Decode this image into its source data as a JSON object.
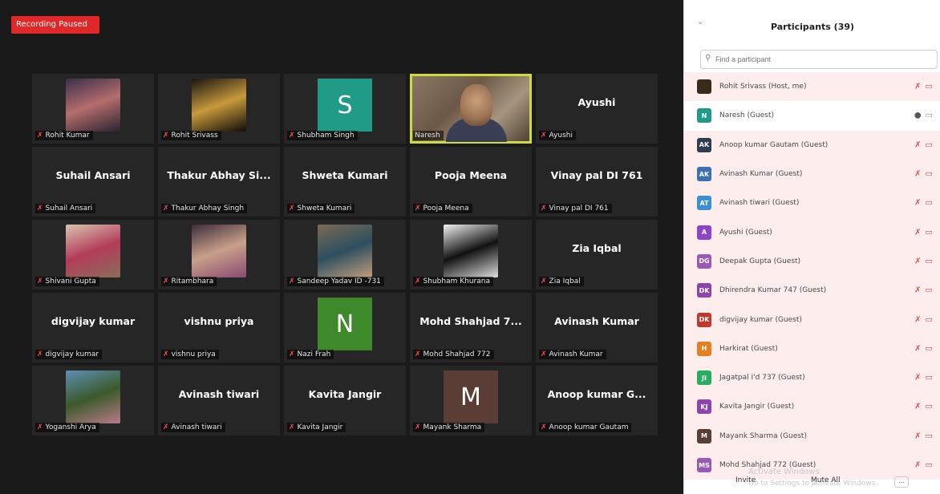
{
  "meeting": {
    "recording_status": "Recording Paused",
    "tiles": [
      {
        "name": "",
        "label": "Rohit Kumar",
        "kind": "photo",
        "photo_colors": [
          "#3b2f4a",
          "#b56d6d",
          "#2a2430"
        ]
      },
      {
        "name": "",
        "label": "Rohit Srivass",
        "kind": "photo",
        "photo_colors": [
          "#1a1410",
          "#c79a3b",
          "#0e0b08"
        ]
      },
      {
        "name": "",
        "label": "Shubham Singh",
        "kind": "letter",
        "letter": "S",
        "color": "#1f9b87"
      },
      {
        "name": "",
        "label": "Naresh",
        "kind": "video",
        "mic": "on"
      },
      {
        "name": "Ayushi",
        "label": "Ayushi",
        "kind": "name"
      },
      {
        "name": "Suhail Ansari",
        "label": "Suhail Ansari",
        "kind": "name"
      },
      {
        "name": "Thakur Abhay Si...",
        "label": "Thakur Abhay Singh",
        "kind": "name"
      },
      {
        "name": "Shweta Kumari",
        "label": "Shweta Kumari",
        "kind": "name"
      },
      {
        "name": "Pooja Meena",
        "label": "Pooja Meena",
        "kind": "name"
      },
      {
        "name": "Vinay pal  DI 761",
        "label": "Vinay pal  DI 761",
        "kind": "name"
      },
      {
        "name": "",
        "label": "Shivani Gupta",
        "kind": "photo",
        "photo_colors": [
          "#d9c5b0",
          "#b33c5a",
          "#8a6e57"
        ]
      },
      {
        "name": "",
        "label": "Ritambhara",
        "kind": "photo",
        "photo_colors": [
          "#3d2c3a",
          "#c8a08a",
          "#8a4a70"
        ]
      },
      {
        "name": "",
        "label": "Sandeep Yadav ID -731",
        "kind": "photo",
        "photo_colors": [
          "#7a6a55",
          "#2d4f5f",
          "#c29d7d"
        ]
      },
      {
        "name": "",
        "label": "Shubham Khurana",
        "kind": "photo",
        "photo_colors": [
          "#f2f2f2",
          "#111111",
          "#dddddd"
        ]
      },
      {
        "name": "Zia Iqbal",
        "label": "Zia Iqbal",
        "kind": "name"
      },
      {
        "name": "digvijay kumar",
        "label": "digvijay kumar",
        "kind": "name"
      },
      {
        "name": "vishnu priya",
        "label": "vishnu priya",
        "kind": "name"
      },
      {
        "name": "",
        "label": "Nazi Frah",
        "kind": "letter",
        "letter": "N",
        "color": "#3e8a2b"
      },
      {
        "name": "Mohd Shahjad 7...",
        "label": "Mohd Shahjad 772",
        "kind": "name"
      },
      {
        "name": "Avinash Kumar",
        "label": "Avinash Kumar",
        "kind": "name"
      },
      {
        "name": "",
        "label": "Yoganshi Arya",
        "kind": "photo",
        "photo_colors": [
          "#5d8fb4",
          "#3b5a2a",
          "#b97a8a"
        ]
      },
      {
        "name": "Avinash tiwari",
        "label": "Avinash tiwari",
        "kind": "name"
      },
      {
        "name": "Kavita Jangir",
        "label": "Kavita Jangir",
        "kind": "name"
      },
      {
        "name": "",
        "label": "Mayank Sharma",
        "kind": "letter",
        "letter": "M",
        "color": "#5a3e35"
      },
      {
        "name": "Anoop kumar G...",
        "label": "Anoop kumar Gautam",
        "kind": "name"
      }
    ]
  },
  "panel": {
    "title": "Participants (39)",
    "search_placeholder": "Find a participant",
    "participants": [
      {
        "initials": "",
        "name": "Rohit Srivass (Host, me)",
        "color": "#3a2a1a",
        "mic": "muted"
      },
      {
        "initials": "N",
        "name": "Naresh (Guest)",
        "color": "#1f9b87",
        "mic": "on"
      },
      {
        "initials": "AK",
        "name": "Anoop kumar Gautam (Guest)",
        "color": "#2c3e50",
        "mic": "muted"
      },
      {
        "initials": "AK",
        "name": "Avinash Kumar (Guest)",
        "color": "#3b6fb6",
        "mic": "muted"
      },
      {
        "initials": "AT",
        "name": "Avinash tiwari (Guest)",
        "color": "#3b8fd6",
        "mic": "muted"
      },
      {
        "initials": "A",
        "name": "Ayushi (Guest)",
        "color": "#8e44c9",
        "mic": "muted"
      },
      {
        "initials": "DG",
        "name": "Deepak Gupta (Guest)",
        "color": "#9b59b6",
        "mic": "muted"
      },
      {
        "initials": "DK",
        "name": "Dhirendra Kumar 747 (Guest)",
        "color": "#8e44ad",
        "mic": "muted"
      },
      {
        "initials": "DK",
        "name": "digvijay kumar (Guest)",
        "color": "#c0392b",
        "mic": "muted"
      },
      {
        "initials": "H",
        "name": "Harkirat (Guest)",
        "color": "#e67e22",
        "mic": "muted"
      },
      {
        "initials": "JI",
        "name": "Jagatpal I'd 737 (Guest)",
        "color": "#27ae60",
        "mic": "muted"
      },
      {
        "initials": "KJ",
        "name": "Kavita Jangir (Guest)",
        "color": "#8e44ad",
        "mic": "muted"
      },
      {
        "initials": "M",
        "name": "Mayank Sharma (Guest)",
        "color": "#5a3e35",
        "mic": "muted"
      },
      {
        "initials": "MS",
        "name": "Mohd Shahjad 772 (Guest)",
        "color": "#9b59b6",
        "mic": "muted"
      }
    ],
    "footer": {
      "invite": "Invite",
      "mute_all": "Mute All",
      "more": "..."
    },
    "watermark_line1": "Activate Windows",
    "watermark_line2": "Go to Settings to activate Windows."
  },
  "icons": {
    "collapse": "chevron-down-icon",
    "search": "search-icon",
    "mic_muted": "mic-muted-icon",
    "cam_off": "camera-off-icon",
    "mic_on": "mic-icon",
    "cam_on": "camera-icon"
  }
}
